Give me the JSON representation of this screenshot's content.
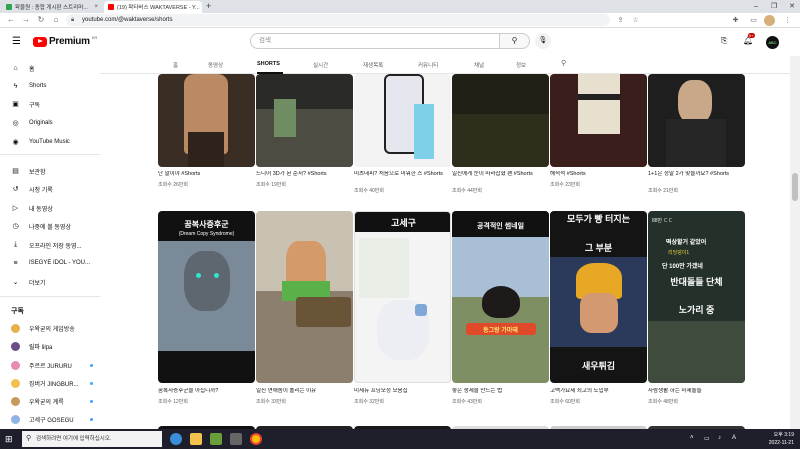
{
  "browser": {
    "tabs": [
      {
        "label": "왁물원 : 종합 게시판 스트리머...",
        "color": "#2da44e"
      },
      {
        "label": "(19) 왁타버스 WAKTAVERSE - Y...",
        "color": "#ff0000"
      }
    ],
    "url": "youtube.com/@waktaverse/shorts"
  },
  "header": {
    "logo_text": "Premium",
    "logo_region": "KR",
    "search_placeholder": "검색",
    "notification_count": "9+",
    "avatar_label": "ABC"
  },
  "sidebar": {
    "main": [
      {
        "label": "홈",
        "icon": "home-icon",
        "glyph": "⌂"
      },
      {
        "label": "Shorts",
        "icon": "shorts-icon",
        "glyph": "ϟ"
      },
      {
        "label": "구독",
        "icon": "subscriptions-icon",
        "glyph": "▣"
      },
      {
        "label": "Originals",
        "icon": "originals-icon",
        "glyph": "◎"
      },
      {
        "label": "YouTube Music",
        "icon": "music-icon",
        "glyph": "◉"
      }
    ],
    "library": [
      {
        "label": "보관함",
        "icon": "library-icon",
        "glyph": "▤"
      },
      {
        "label": "시청 기록",
        "icon": "history-icon",
        "glyph": "↺"
      },
      {
        "label": "내 동영상",
        "icon": "my-videos-icon",
        "glyph": "▷"
      },
      {
        "label": "나중에 볼 동영상",
        "icon": "watch-later-icon",
        "glyph": "◷"
      },
      {
        "label": "오프라인 저장 동영...",
        "icon": "download-icon",
        "glyph": "⤓"
      },
      {
        "label": "ISEGYE IDOL - YOU...",
        "icon": "playlist-icon",
        "glyph": "≡"
      },
      {
        "label": "더보기",
        "icon": "chevron-down-icon",
        "glyph": "⌄"
      }
    ],
    "subscriptions_heading": "구독",
    "subscriptions": [
      {
        "label": "우왁굳의 게임방송",
        "color": "#e8b04a",
        "dot": false
      },
      {
        "label": "릴파 lilpa",
        "color": "#6d4c8a",
        "dot": false
      },
      {
        "label": "주르르 JURURU",
        "color": "#e98bb0",
        "dot": true
      },
      {
        "label": "징버거 JINGBUR...",
        "color": "#f2c14e",
        "dot": true
      },
      {
        "label": "우왁굳의 계륵",
        "color": "#c79a5b",
        "dot": true
      },
      {
        "label": "고세구 GOSEGU",
        "color": "#8fb4e6",
        "dot": true
      }
    ]
  },
  "channel_tabs": [
    "홈",
    "동영상",
    "SHORTS",
    "실시간",
    "재생목록",
    "커뮤니티",
    "채널",
    "정보"
  ],
  "shorts_row1": [
    {
      "title": "난 말이야 #Shorts",
      "views": "조회수 26만회",
      "bg": "#3a2d23"
    },
    {
      "title": "드디어 3D가 된 순서? #Shorts",
      "views": "조회수 19만회",
      "bg": "#2a2a28"
    },
    {
      "title": "미츠데피? 처음으로 미워한 스 #Shorts",
      "views": "조회수 40만회",
      "bg": "#f3f3f3"
    },
    {
      "title": "일진에게 눈이 따라잡혔 팬 #Shorts",
      "views": "조회수 44만회",
      "bg": "#202015"
    },
    {
      "title": "해적석 #Shorts",
      "views": "조회수 23만회",
      "bg": "#3a1e1c"
    },
    {
      "title": "1+1은 정말 2가 맞을까요? #Shorts",
      "views": "조회수 21만회",
      "bg": "#1e1e1e"
    }
  ],
  "shorts_row2": [
    {
      "title": "꿈복사증후군을 아십니까?",
      "views": "조회수 12만회",
      "bg": "#111111",
      "cap1": "꿈복사증후군",
      "cap2": "(Dream Copy Syndrome)"
    },
    {
      "title": "일진 연애놈이 폴리는 이유",
      "views": "조회수 33만회",
      "bg": "#c9c1b1",
      "cap1": "",
      "cap2": ""
    },
    {
      "title": "미세뉴 프닝모정 모음집",
      "views": "조회수 32만회",
      "bg": "#f4f4f4",
      "cap1": "고세구",
      "cap2": ""
    },
    {
      "title": "좋은 생세을 만드는 법",
      "views": "조회수 43만회",
      "bg": "#7e8f63",
      "cap1": "공격적인 썸네일",
      "cap2": "동그랑 가마돼"
    },
    {
      "title": "고백가요제 최고의 도입부",
      "views": "조회수 60만회",
      "bg": "#141414",
      "cap1": "모두가 빵 터지는",
      "cap2": "그 부분",
      "cap3": "새우튀김"
    },
    {
      "title": "사람생활 하는 미세돌들",
      "views": "조회수 48만회",
      "bg": "#24302a",
      "cap1": "반대돌들 단체",
      "cap2": "노가리 중",
      "chat1": "88만 ㄷㄷ",
      "chat2": "떡상할거 같았어",
      "chat3": "리딩덩이1",
      "chat4": "단 100만 가겠네"
    }
  ],
  "taskbar": {
    "search_placeholder": "검색하려면 여기에 입력하십시오.",
    "time": "오후 3:19",
    "date": "2022-11-21"
  }
}
